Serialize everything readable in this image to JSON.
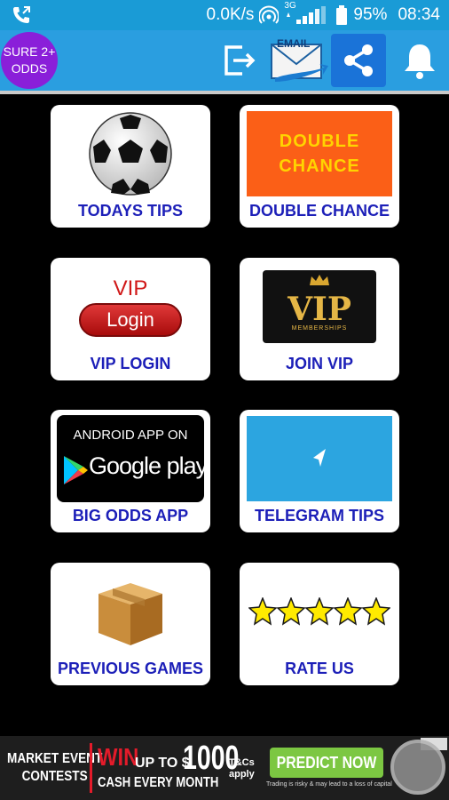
{
  "status": {
    "speed": "0.0K/s",
    "network": "3G",
    "battery": "95%",
    "time": "08:34"
  },
  "header": {
    "logo_line1": "SURE 2+",
    "logo_line2": "ODDS",
    "email_label": "EMAIL"
  },
  "tiles": [
    {
      "label": "TODAYS TIPS"
    },
    {
      "label": "DOUBLE CHANCE",
      "art_line1": "DOUBLE",
      "art_line2": "CHANCE"
    },
    {
      "label": "VIP LOGIN",
      "art_top": "VIP",
      "art_button": "Login"
    },
    {
      "label": "JOIN VIP",
      "art_main": "VIP",
      "art_sub": "MEMBERSHIPS"
    },
    {
      "label": "BIG ODDS APP",
      "art_top": "ANDROID APP ON",
      "art_main": "Google play"
    },
    {
      "label": "TELEGRAM TIPS"
    },
    {
      "label": "PREVIOUS GAMES"
    },
    {
      "label": "RATE US",
      "stars": 5
    }
  ],
  "ad": {
    "left_line1": "MARKET EVENT",
    "left_line2": "CONTESTS",
    "win": "WIN",
    "upto": "UP TO $",
    "amount": "1000",
    "cash": "CASH EVERY MONTH",
    "tcs1": "T&Cs",
    "tcs2": "apply",
    "cta": "PREDICT NOW",
    "disclaimer": "Trading is risky & may lead to a loss of capital"
  },
  "colors": {
    "status_bar": "#1a9bd6",
    "app_bar": "#2a9ee0",
    "tile_label": "#1c1fb8",
    "logo_bg": "#8a1fd9"
  }
}
